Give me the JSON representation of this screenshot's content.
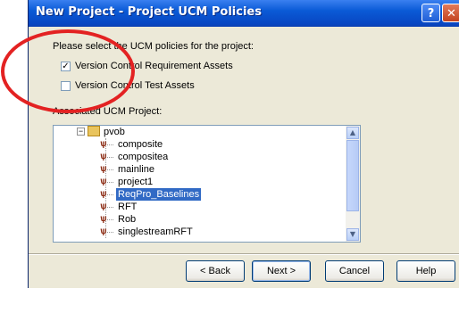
{
  "window": {
    "title": "New Project - Project UCM Policies",
    "help_glyph": "?",
    "close_glyph": "✕"
  },
  "content": {
    "instruction": "Please select the UCM policies for the project:",
    "checkboxes": [
      {
        "label": "Version Control Requirement Assets",
        "checked": true,
        "glyph": "✓"
      },
      {
        "label": "Version Control Test Assets",
        "checked": false,
        "glyph": ""
      }
    ],
    "associated_label": "Associated UCM Project:",
    "tree": {
      "root": {
        "label": "pvob",
        "expander": "−"
      },
      "items": [
        {
          "label": "composite",
          "selected": false
        },
        {
          "label": "compositea",
          "selected": false
        },
        {
          "label": "mainline",
          "selected": false
        },
        {
          "label": "project1",
          "selected": false
        },
        {
          "label": "ReqPro_Baselines",
          "selected": true
        },
        {
          "label": "RFT",
          "selected": false
        },
        {
          "label": "Rob",
          "selected": false
        },
        {
          "label": "singlestreamRFT",
          "selected": false
        }
      ]
    },
    "scroll_up": "▲",
    "scroll_down": "▼"
  },
  "buttons": {
    "back": "< Back",
    "next": "Next >",
    "cancel": "Cancel",
    "help": "Help"
  },
  "icon_glyph": "ѱ",
  "highlight_color": "#e32222"
}
